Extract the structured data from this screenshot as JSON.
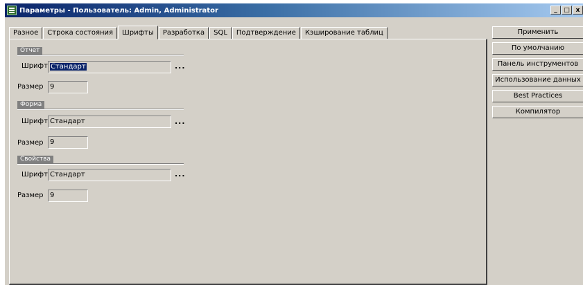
{
  "window": {
    "title": "Параметры - Пользователь: Admin, Administrator",
    "controls": [
      "_",
      "□",
      "x"
    ]
  },
  "tabs": [
    {
      "label": "Разное"
    },
    {
      "label": "Строка состояния"
    },
    {
      "label": "Шрифты",
      "active": true
    },
    {
      "label": "Разработка"
    },
    {
      "label": "SQL"
    },
    {
      "label": "Подтверждение"
    },
    {
      "label": "Кэширование таблиц"
    }
  ],
  "groups": {
    "report": {
      "title": "Отчет",
      "font_label": "Шрифт",
      "font_value": "Стандарт",
      "size_label": "Размер",
      "size_value": "9",
      "browse": "..."
    },
    "form": {
      "title": "Форма",
      "font_label": "Шрифт",
      "font_value": "Стандарт",
      "size_label": "Размер",
      "size_value": "9",
      "browse": "..."
    },
    "properties": {
      "title": "Свойства",
      "font_label": "Шрифт",
      "font_value": "Стандарт",
      "size_label": "Размер",
      "size_value": "9",
      "browse": "..."
    }
  },
  "side_buttons": {
    "apply": "Применить",
    "defaults": "По умолчанию",
    "toolbar": "Панель инструментов",
    "data_usage": "Использование данных",
    "best_practices": "Best Practices",
    "compiler": "Компилятор"
  }
}
